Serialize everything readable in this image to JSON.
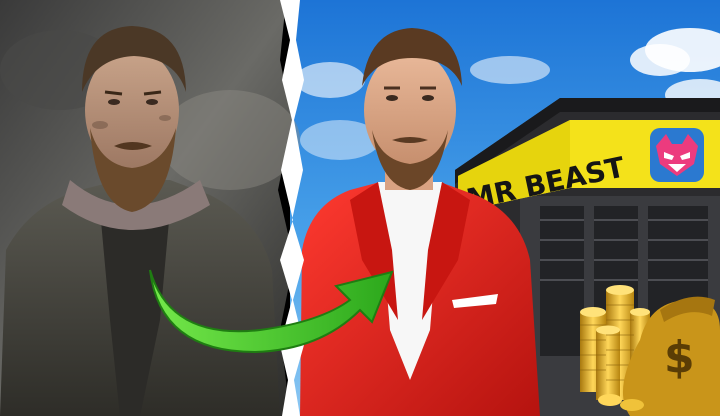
{
  "thumbnail": {
    "store_sign_text": "MR BEAST",
    "dollar_symbol": "$",
    "colors": {
      "sky": "#2f8fe0",
      "sign_yellow": "#f4e21a",
      "suit_red": "#e0201c",
      "arrow_green": "#3fcf2a",
      "gold": "#e6b022",
      "brand_blue": "#2b79d0",
      "brand_pink": "#ec3b7e"
    },
    "icons": {
      "arrow": "curved-arrow-icon",
      "logo": "beast-logo-icon",
      "money_bag": "money-bag-icon"
    }
  }
}
